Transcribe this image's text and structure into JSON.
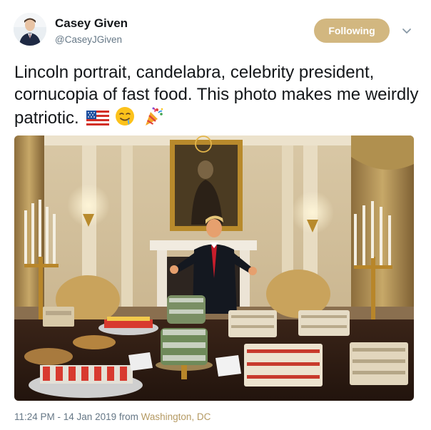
{
  "user": {
    "name": "Casey Given",
    "handle": "@CaseyJGiven"
  },
  "actions": {
    "follow_label": "Following"
  },
  "tweet": {
    "text": "Lincoln portrait, candelabra, celebrity president, cornucopia of fast food. This photo makes me weirdly patriotic.",
    "emojis": [
      "us-flag-icon",
      "drooling-face-icon",
      "party-popper-icon"
    ]
  },
  "meta": {
    "timestamp": "11:24 PM - 14 Jan 2019",
    "from_label": "from",
    "location": "Washington, DC"
  },
  "colors": {
    "follow_button": "#d2b780",
    "location_link": "#b59a63",
    "secondary_text": "#657786"
  }
}
